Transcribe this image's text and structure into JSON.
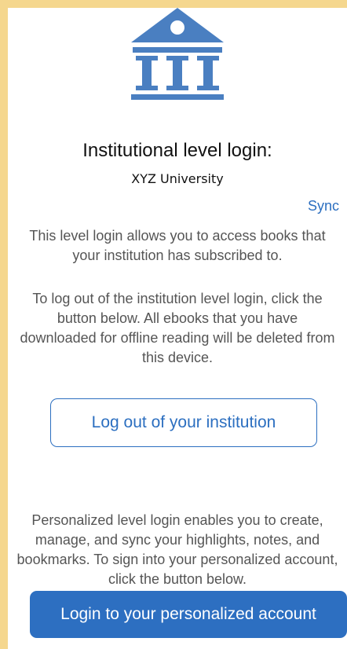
{
  "header": {
    "logo_icon": "institution-building-icon",
    "title": "Institutional level login:",
    "institution_name": "XYZ University",
    "sync_label": "Sync"
  },
  "institution_section": {
    "description": "This level login allows you to access books that your institution has subscribed to.",
    "logout_info": "To log out of the institution level login, click the button below. All ebooks that you have downloaded for offline reading will be deleted from this device.",
    "logout_button_label": "Log out of your institution"
  },
  "personal_section": {
    "description": "Personalized level login enables you to create, manage, and sync your highlights, notes, and bookmarks. To sign into your personalized account, click the button below.",
    "login_button_label": "Login to your personalized account"
  },
  "colors": {
    "accent": "#2c6fc0",
    "icon": "#4a7fc1",
    "frame": "#f5d78e",
    "body_text": "#555555"
  }
}
